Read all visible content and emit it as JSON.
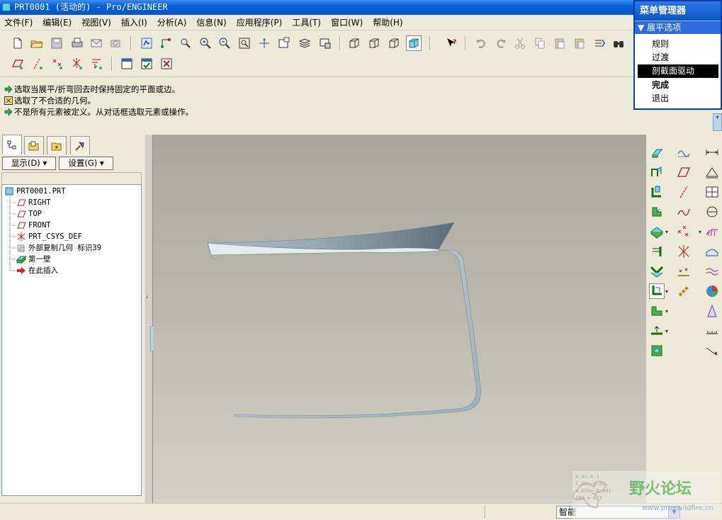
{
  "window": {
    "title": "PRT0001 (活动的) - Pro/ENGINEER"
  },
  "menubar": {
    "items": [
      "文件(F)",
      "编辑(E)",
      "视图(V)",
      "插入(I)",
      "分析(A)",
      "信息(N)",
      "应用程序(P)",
      "工具(T)",
      "窗口(W)",
      "帮助(H)"
    ]
  },
  "messages": [
    {
      "icon": "arrow-right-icon",
      "text": "选取当展平/折弯回去时保持固定的平面或边。"
    },
    {
      "icon": "warning-icon",
      "text": "选取了不合适的几何。"
    },
    {
      "icon": "arrow-right-icon",
      "text": "不是所有元素被定义。从对话框选取元素或操作。"
    }
  ],
  "panel": {
    "show_label": "显示(D)",
    "settings_label": "设置(G)"
  },
  "tree": [
    {
      "label": "PRT0001.PRT",
      "icon": "part-icon"
    },
    {
      "label": "RIGHT",
      "icon": "datum-plane-icon"
    },
    {
      "label": "TOP",
      "icon": "datum-plane-icon"
    },
    {
      "label": "FRONT",
      "icon": "datum-plane-icon"
    },
    {
      "label": "PRT_CSYS_DEF",
      "icon": "csys-icon"
    },
    {
      "label": "外部复制几何 标识39",
      "icon": "copy-geometry-icon"
    },
    {
      "label": "第一壁",
      "icon": "wall-icon"
    },
    {
      "label": "在此插入",
      "icon": "insert-arrow-icon"
    }
  ],
  "menu_manager": {
    "title": "菜单管理器",
    "section": "展平选项",
    "items": [
      {
        "label": "规则",
        "selected": false,
        "bold": false
      },
      {
        "label": "过渡",
        "selected": false,
        "bold": false
      },
      {
        "label": "剖截面驱动",
        "selected": true,
        "bold": false
      },
      {
        "label": "完成",
        "selected": false,
        "bold": true
      },
      {
        "label": "退出",
        "selected": false,
        "bold": false
      }
    ]
  },
  "status": {
    "filter_value": "智能"
  },
  "watermark": {
    "text": "野火论坛",
    "url": "www.proewildfire.cn",
    "coords": [
      "X.X±-0.1",
      "X.XX±-0.01",
      "X.XXX±-0.001",
      "ANG ±-0.5"
    ]
  },
  "colors": {
    "title_bar": "#0A5FD6",
    "viewport_top": "#A9A79B",
    "viewport_bottom": "#D2D1C7",
    "model": "#A6B3BC",
    "selected_item": "#000000"
  }
}
